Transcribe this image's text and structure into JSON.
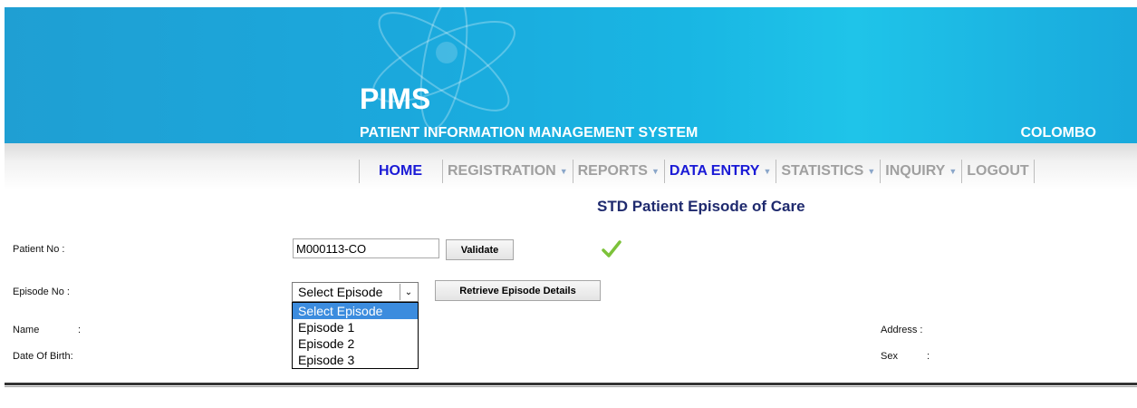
{
  "header": {
    "app_name": "PIMS",
    "app_subtitle": "PATIENT INFORMATION MANAGEMENT SYSTEM",
    "location": "COLOMBO",
    "colors": {
      "banner": "#1BAEE0",
      "header_text": "#FFFFFF"
    }
  },
  "nav": {
    "items": [
      {
        "label": "HOME",
        "has_menu": false,
        "active": true
      },
      {
        "label": "REGISTRATION",
        "has_menu": true,
        "active": false
      },
      {
        "label": "REPORTS",
        "has_menu": true,
        "active": false
      },
      {
        "label": "DATA ENTRY",
        "has_menu": true,
        "active": true
      },
      {
        "label": "STATISTICS",
        "has_menu": true,
        "active": false
      },
      {
        "label": "INQUIRY",
        "has_menu": true,
        "active": false
      },
      {
        "label": "LOGOUT",
        "has_menu": false,
        "active": false
      }
    ],
    "colors": {
      "active": "#1A1AD6",
      "inactive": "#A0A0A0"
    }
  },
  "page": {
    "title": "STD Patient Episode of Care"
  },
  "form": {
    "patient_no_label": "Patient No  :",
    "patient_no_value": "M000113-CO",
    "validate_button": "Validate",
    "validated_icon": "checkmark-icon",
    "episode_no_label": "Episode No :",
    "episode_select": {
      "selected": "Select Episode",
      "options": [
        "Select Episode",
        "Episode 1",
        "Episode 2",
        "Episode 3"
      ],
      "highlighted_option": "Select Episode",
      "is_open": true
    },
    "retrieve_button": "Retrieve Episode Details",
    "name_label": "Name",
    "name_colon": ":",
    "dob_label": "Date Of Birth:",
    "address_label": "Address  :",
    "sex_label": "Sex",
    "sex_colon": ":"
  }
}
